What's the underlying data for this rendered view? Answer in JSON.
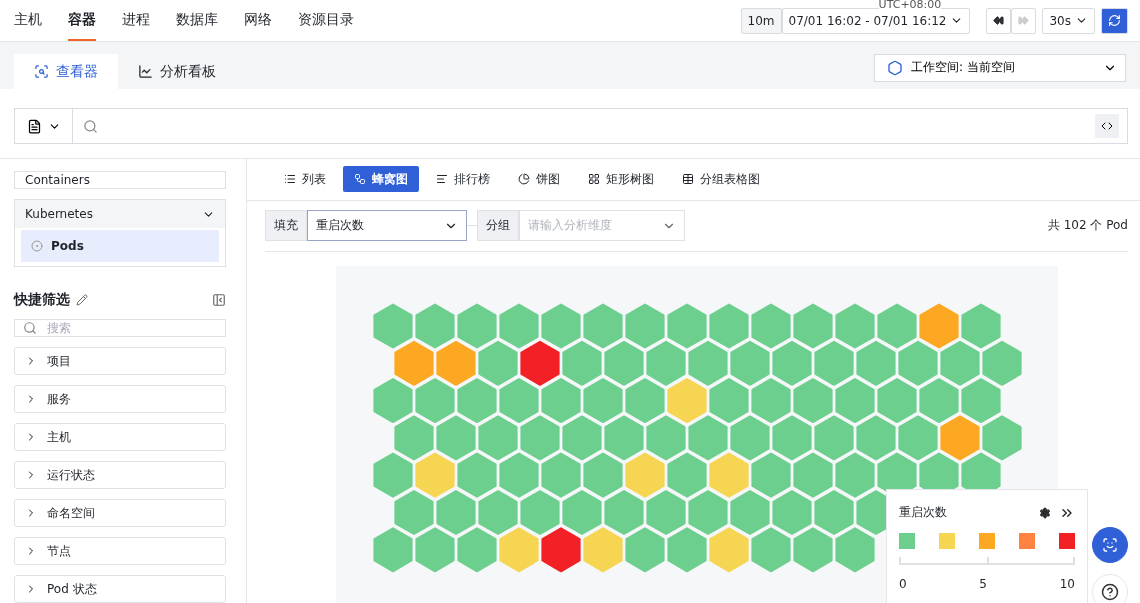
{
  "nav": {
    "items": [
      {
        "label": "主机",
        "selected": false
      },
      {
        "label": "容器",
        "selected": true
      },
      {
        "label": "进程",
        "selected": false
      },
      {
        "label": "数据库",
        "selected": false
      },
      {
        "label": "网络",
        "selected": false
      },
      {
        "label": "资源目录",
        "selected": false
      }
    ]
  },
  "time": {
    "timezone": "UTC+08:00",
    "quick": "10m",
    "range": "07/01 16:02 - 07/01 16:12",
    "forward_disabled": true,
    "interval": "30s"
  },
  "tabs": [
    {
      "label": "查看器",
      "kind": "viewer",
      "selected": true
    },
    {
      "label": "分析看板",
      "kind": "dashboard",
      "selected": false
    }
  ],
  "workspace": {
    "label": "工作空间: 当前空间"
  },
  "sidebar": {
    "sources": [
      {
        "label": "Containers"
      }
    ],
    "group": {
      "label": "Kubernetes",
      "expanded": true,
      "children": [
        {
          "label": "Pods",
          "selected": true
        }
      ]
    },
    "quick_filter": {
      "title": "快捷筛选",
      "search_placeholder": "搜索",
      "items": [
        {
          "label": "项目",
          "expanded": false
        },
        {
          "label": "服务",
          "expanded": false
        },
        {
          "label": "主机",
          "expanded": false
        },
        {
          "label": "运行状态",
          "expanded": false
        },
        {
          "label": "命名空间",
          "expanded": false
        },
        {
          "label": "节点",
          "expanded": false
        },
        {
          "label": "Pod 状态",
          "expanded": false
        }
      ]
    }
  },
  "views": [
    {
      "label": "列表",
      "kind": "list",
      "selected": false
    },
    {
      "label": "蜂窝图",
      "kind": "honeycomb",
      "selected": true
    },
    {
      "label": "排行榜",
      "kind": "ranking",
      "selected": false
    },
    {
      "label": "饼图",
      "kind": "pie",
      "selected": false
    },
    {
      "label": "矩形树图",
      "kind": "treemap",
      "selected": false
    },
    {
      "label": "分组表格图",
      "kind": "table",
      "selected": false
    }
  ],
  "controls": {
    "fill": {
      "label": "填充",
      "value": "重启次数"
    },
    "group": {
      "label": "分组",
      "placeholder": "请输入分析维度"
    },
    "count": "共 102 个 Pod"
  },
  "honeycomb": {
    "rows": [
      [
        {
          "color": "#6dcf8e"
        },
        {
          "color": "#6dcf8e"
        },
        {
          "color": "#6dcf8e"
        },
        {
          "color": "#6dcf8e"
        },
        {
          "color": "#6dcf8e"
        },
        {
          "color": "#6dcf8e"
        },
        {
          "color": "#6dcf8e"
        },
        {
          "color": "#6dcf8e"
        },
        {
          "color": "#6dcf8e"
        },
        {
          "color": "#6dcf8e"
        },
        {
          "color": "#6dcf8e"
        },
        {
          "color": "#6dcf8e"
        },
        {
          "color": "#6dcf8e"
        },
        {
          "color": "#fda822"
        },
        {
          "color": "#6dcf8e"
        }
      ],
      [
        {
          "color": "#fda822"
        },
        {
          "color": "#fda822"
        },
        {
          "color": "#6dcf8e"
        },
        {
          "color": "#f22125"
        },
        {
          "color": "#6dcf8e"
        },
        {
          "color": "#6dcf8e"
        },
        {
          "color": "#6dcf8e"
        },
        {
          "color": "#6dcf8e"
        },
        {
          "color": "#6dcf8e"
        },
        {
          "color": "#6dcf8e"
        },
        {
          "color": "#6dcf8e"
        },
        {
          "color": "#6dcf8e"
        },
        {
          "color": "#6dcf8e"
        },
        {
          "color": "#6dcf8e"
        },
        {
          "color": "#6dcf8e"
        }
      ],
      [
        {
          "color": "#6dcf8e"
        },
        {
          "color": "#6dcf8e"
        },
        {
          "color": "#6dcf8e"
        },
        {
          "color": "#6dcf8e"
        },
        {
          "color": "#6dcf8e"
        },
        {
          "color": "#6dcf8e"
        },
        {
          "color": "#6dcf8e"
        },
        {
          "color": "#f6d552"
        },
        {
          "color": "#6dcf8e"
        },
        {
          "color": "#6dcf8e"
        },
        {
          "color": "#6dcf8e"
        },
        {
          "color": "#6dcf8e"
        },
        {
          "color": "#6dcf8e"
        },
        {
          "color": "#6dcf8e"
        },
        {
          "color": "#6dcf8e"
        }
      ],
      [
        {
          "color": "#6dcf8e"
        },
        {
          "color": "#6dcf8e"
        },
        {
          "color": "#6dcf8e"
        },
        {
          "color": "#6dcf8e"
        },
        {
          "color": "#6dcf8e"
        },
        {
          "color": "#6dcf8e"
        },
        {
          "color": "#6dcf8e"
        },
        {
          "color": "#6dcf8e"
        },
        {
          "color": "#6dcf8e"
        },
        {
          "color": "#6dcf8e"
        },
        {
          "color": "#6dcf8e"
        },
        {
          "color": "#6dcf8e"
        },
        {
          "color": "#6dcf8e"
        },
        {
          "color": "#fda822"
        },
        {
          "color": "#6dcf8e"
        }
      ],
      [
        {
          "color": "#6dcf8e"
        },
        {
          "color": "#f6d552"
        },
        {
          "color": "#6dcf8e"
        },
        {
          "color": "#6dcf8e"
        },
        {
          "color": "#6dcf8e"
        },
        {
          "color": "#6dcf8e"
        },
        {
          "color": "#f6d552"
        },
        {
          "color": "#6dcf8e"
        },
        {
          "color": "#f6d552"
        },
        {
          "color": "#6dcf8e"
        },
        {
          "color": "#6dcf8e"
        },
        {
          "color": "#6dcf8e"
        },
        {
          "color": "#6dcf8e"
        },
        {
          "color": "#6dcf8e"
        },
        {
          "color": "#6dcf8e"
        }
      ],
      [
        {
          "color": "#6dcf8e"
        },
        {
          "color": "#6dcf8e"
        },
        {
          "color": "#6dcf8e"
        },
        {
          "color": "#6dcf8e"
        },
        {
          "color": "#6dcf8e"
        },
        {
          "color": "#6dcf8e"
        },
        {
          "color": "#6dcf8e"
        },
        {
          "color": "#6dcf8e"
        },
        {
          "color": "#6dcf8e"
        },
        {
          "color": "#6dcf8e"
        },
        {
          "color": "#6dcf8e"
        },
        {
          "color": "#6dcf8e"
        }
      ],
      [
        {
          "color": "#6dcf8e"
        },
        {
          "color": "#6dcf8e"
        },
        {
          "color": "#6dcf8e"
        },
        {
          "color": "#f6d552"
        },
        {
          "color": "#f22125"
        },
        {
          "color": "#f6d552"
        },
        {
          "color": "#6dcf8e"
        },
        {
          "color": "#6dcf8e"
        },
        {
          "color": "#f6d552"
        },
        {
          "color": "#6dcf8e"
        },
        {
          "color": "#6dcf8e"
        },
        {
          "color": "#6dcf8e"
        }
      ]
    ]
  },
  "legend": {
    "title": "重启次数",
    "colors": [
      {
        "color": "#6dcf8e"
      },
      {
        "color": "#f6d552"
      },
      {
        "color": "#fda822"
      },
      {
        "color": "#fe8341"
      },
      {
        "color": "#f22125"
      }
    ],
    "ticks": [
      "0",
      "5",
      "10"
    ]
  }
}
